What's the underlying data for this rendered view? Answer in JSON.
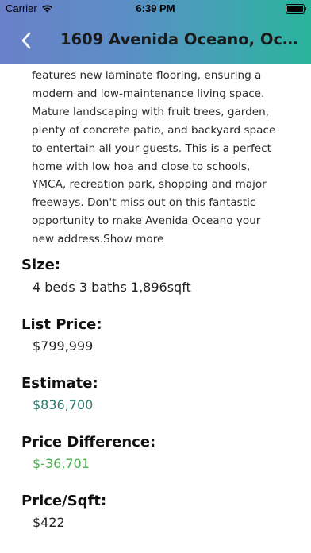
{
  "status_bar": {
    "carrier": "Carrier",
    "time": "6:39 PM"
  },
  "nav": {
    "title": "1609 Avenida Oceano, Oce..."
  },
  "description": {
    "lines": [
      "features new laminate flooring, ensuring a",
      "modern and low-maintenance living space.",
      "Mature landscaping with fruit trees, garden,",
      "plenty of concrete patio, and backyard space",
      "to entertain all your guests. This is a perfect",
      "home with low hoa and close to schools,",
      "YMCA, recreation park, shopping and major",
      "freeways. Don't miss out on this fantastic",
      "opportunity to make Avenida Oceano your"
    ],
    "last_line": "new address.",
    "show_more": "Show more"
  },
  "fields": {
    "size": {
      "label": "Size:",
      "value": "4 beds 3 baths 1,896sqft"
    },
    "list_price": {
      "label": "List Price:",
      "value": "$799,999"
    },
    "estimate": {
      "label": "Estimate:",
      "value": "$836,700"
    },
    "price_difference": {
      "label": "Price Difference:",
      "value": "$-36,701"
    },
    "price_sqft": {
      "label": "Price/Sqft:",
      "value": "$422"
    }
  },
  "colors": {
    "estimate": "#2b7a6e",
    "price_difference": "#4caf50",
    "gradient_start": "#6a80c8",
    "gradient_end": "#2ab39c"
  }
}
